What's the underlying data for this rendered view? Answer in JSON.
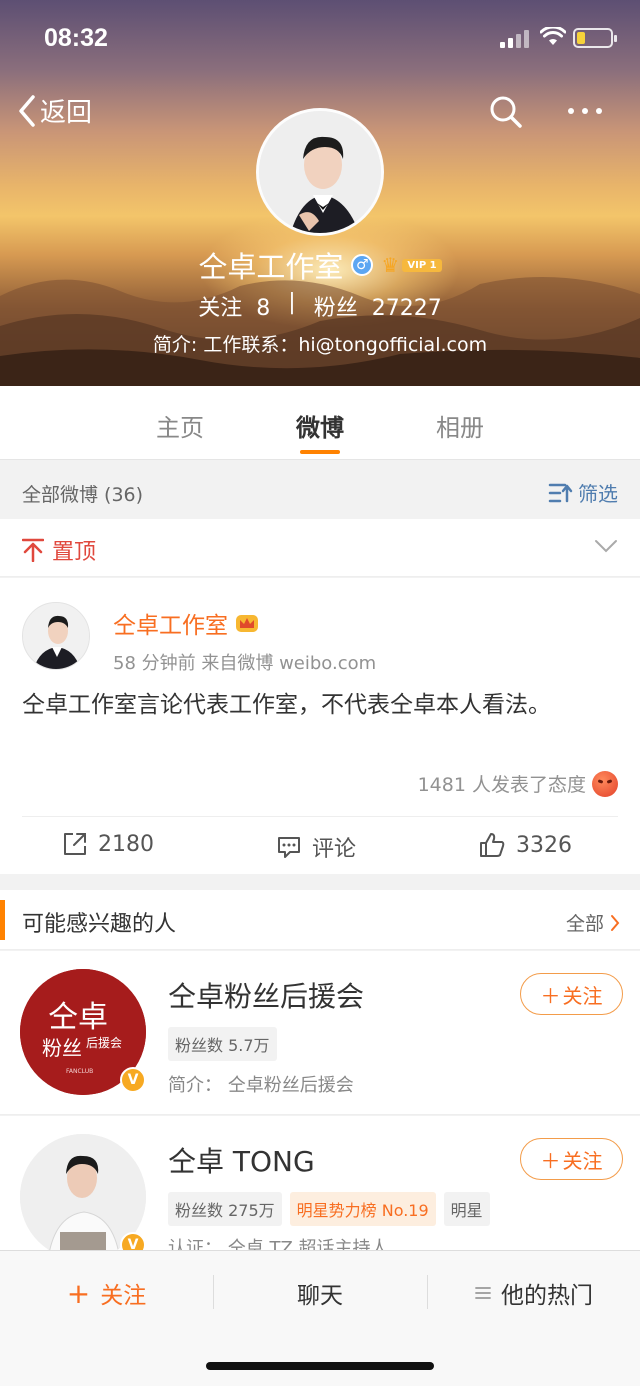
{
  "status": {
    "time": "08:32"
  },
  "nav": {
    "back_label": "返回"
  },
  "profile": {
    "name": "仝卓工作室",
    "vip_label": "VIP 1",
    "following_label": "关注",
    "following_count": "8",
    "separator": "|",
    "followers_label": "粉丝",
    "followers_count": "27227",
    "bio": "简介: 工作联系：hi@tongofficial.com"
  },
  "tabs": [
    {
      "label": "主页",
      "active": false
    },
    {
      "label": "微博",
      "active": true
    },
    {
      "label": "相册",
      "active": false
    }
  ],
  "filter_bar": {
    "count_label": "全部微博 (36)",
    "filter_label": "筛选"
  },
  "pinned": {
    "label": "置顶"
  },
  "post": {
    "author": "仝卓工作室",
    "meta": "58 分钟前  来自微博 weibo.com",
    "text": "仝卓工作室言论代表工作室，不代表仝卓本人看法。",
    "reactions": "1481 人发表了态度",
    "repost_count": "2180",
    "comment_label": "评论",
    "like_count": "3326"
  },
  "suggestions": {
    "title": "可能感兴趣的人",
    "all_label": "全部",
    "people": [
      {
        "name": "仝卓粉丝后援会",
        "follow_label": "关注",
        "tags": [
          {
            "text": "粉丝数 5.7万",
            "hot": false
          }
        ],
        "desc": "简介： 仝卓粉丝后援会",
        "avatar_text_1": "仝卓",
        "avatar_text_2": "粉丝",
        "avatar_text_3": "后援会",
        "avatar_small": "FANCLUB"
      },
      {
        "name": "仝卓 TONG",
        "follow_label": "关注",
        "tags": [
          {
            "text": "粉丝数 275万",
            "hot": false
          },
          {
            "text": "明星势力榜 No.19",
            "hot": true
          },
          {
            "text": "明星",
            "hot": false
          }
        ],
        "desc": "认证： 仝卓 TZ 超话主持人"
      }
    ]
  },
  "bottom_bar": {
    "follow_label": "关注",
    "chat_label": "聊天",
    "hot_label": "他的热门"
  },
  "colors": {
    "accent": "#ff8200",
    "link": "#507daf",
    "author": "#f86e21"
  }
}
